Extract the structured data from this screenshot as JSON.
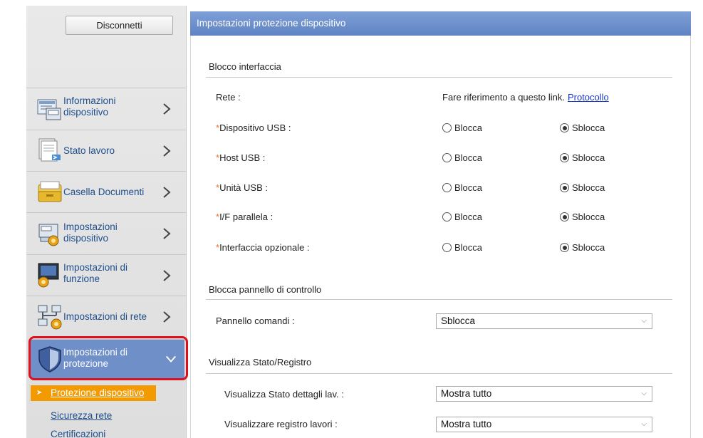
{
  "sidebar": {
    "disconnect_label": "Disconnetti",
    "items": [
      {
        "id": "info",
        "label_line1": "Informazioni",
        "label_line2": "dispositivo",
        "icon": "device-info-icon"
      },
      {
        "id": "job",
        "label_line1": "Stato lavoro",
        "label_line2": "",
        "icon": "job-status-icon"
      },
      {
        "id": "box",
        "label_line1": "Casella Documenti",
        "label_line2": "",
        "icon": "document-box-icon"
      },
      {
        "id": "devset",
        "label_line1": "Impostazioni",
        "label_line2": "dispositivo",
        "icon": "device-settings-icon"
      },
      {
        "id": "funcset",
        "label_line1": "Impostazioni di",
        "label_line2": "funzione",
        "icon": "function-settings-icon"
      },
      {
        "id": "netset",
        "label_line1": "Impostazioni di rete",
        "label_line2": "",
        "icon": "network-settings-icon"
      },
      {
        "id": "security",
        "label_line1": "Impostazioni di",
        "label_line2": "protezione",
        "icon": "shield-icon"
      }
    ],
    "subitems": [
      {
        "label": "Protezione dispositivo"
      },
      {
        "label": "Sicurezza rete"
      },
      {
        "label": "Certificazioni"
      }
    ]
  },
  "panel": {
    "title": "Impostazioni protezione dispositivo",
    "section1": "Blocco interfaccia",
    "network_label": "Rete :",
    "network_text": "Fare riferimento a questo link.",
    "network_link": "Protocollo",
    "lock_label": "Blocca",
    "unlock_label": "Sblocca",
    "rows": [
      {
        "label": "Dispositivo USB :",
        "value": "Sblocca"
      },
      {
        "label": "Host USB :",
        "value": "Sblocca"
      },
      {
        "label": "Unità USB :",
        "value": "Sblocca"
      },
      {
        "label": "I/F parallela :",
        "value": "Sblocca"
      },
      {
        "label": "Interfaccia opzionale :",
        "value": "Sblocca"
      }
    ],
    "section2": "Blocca pannello di controllo",
    "control_panel_label": "Pannello comandi :",
    "control_panel_value": "Sblocca",
    "section3": "Visualizza Stato/Registro",
    "status_label": "Visualizza Stato dettagli lav. :",
    "status_value": "Mostra tutto",
    "log_label": "Visualizzare registro lavori :",
    "log_value": "Mostra tutto"
  },
  "colors": {
    "accent": "#6f8fc9",
    "highlight": "#e0101a",
    "active_sub": "#f29a00",
    "required_mark": "#e8722a"
  }
}
